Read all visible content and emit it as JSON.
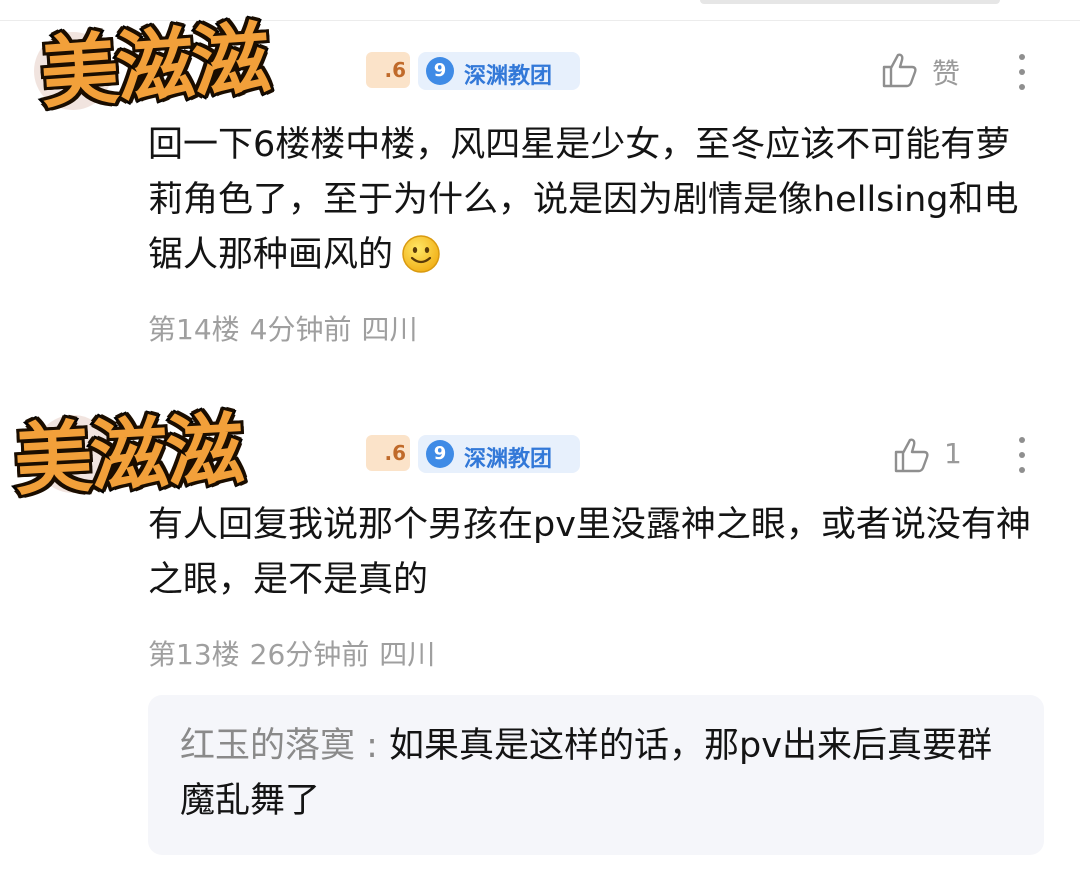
{
  "comments": [
    {
      "level_suffix": ".6",
      "badge_level": "9",
      "badge_name": "深渊教团",
      "like_label": "赞",
      "text": "回一下6楼楼中楼，风四星是少女，至冬应该不可能有萝莉角色了，至于为什么，说是因为剧情是像hellsing和电锯人那种画风的",
      "emoji": "smiley-emoji",
      "floor": "第14楼",
      "time": "4分钟前",
      "location": "四川",
      "sticker": "美滋滋"
    },
    {
      "level_suffix": ".6",
      "badge_level": "9",
      "badge_name": "深渊教团",
      "like_label": "1",
      "text": "有人回复我说那个男孩在pv里没露神之眼，或者说没有神之眼，是不是真的",
      "floor": "第13楼",
      "time": "26分钟前",
      "location": "四川",
      "sticker": "美滋滋",
      "reply": {
        "user": "红玉的落寞 : ",
        "text": "如果真是这样的话，那pv出来后真要群魔乱舞了"
      }
    }
  ],
  "colors": {
    "badge_bg": "#e7f0fc",
    "badge_text": "#3278d8",
    "meta_gray": "#9f9f9f",
    "sticker_red": "#e8461f",
    "sticker_orange": "#f2a03a"
  }
}
